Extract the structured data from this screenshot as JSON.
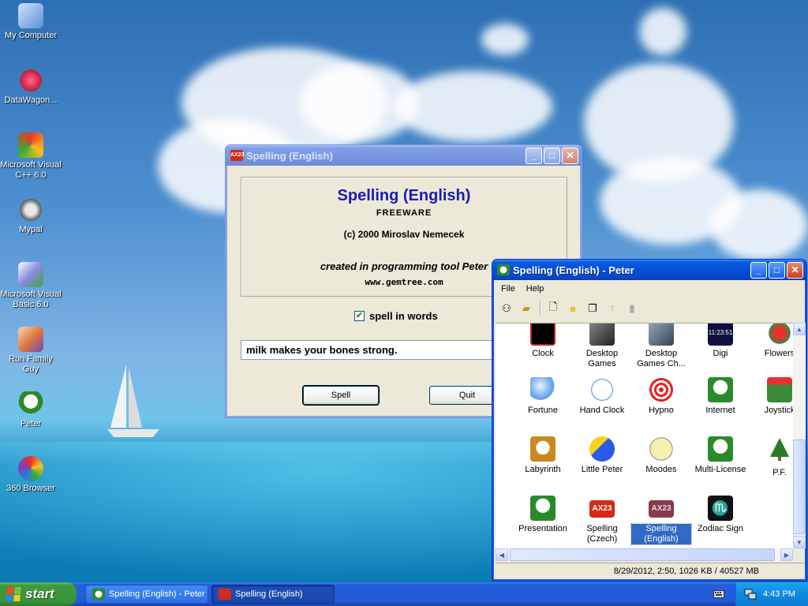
{
  "desktop": {
    "icons": [
      {
        "label": "My Computer"
      },
      {
        "label": "DataWagon..."
      },
      {
        "label": "Microsoft Visual C++ 6.0"
      },
      {
        "label": "Mypal"
      },
      {
        "label": "Microsoft Visual Basic 6.0"
      },
      {
        "label": "Run Family Guy"
      },
      {
        "label": "Peter"
      },
      {
        "label": "360 Browser"
      }
    ]
  },
  "spelling_window": {
    "title": "Spelling (English)",
    "icon_text": "AX23",
    "about": {
      "title": "Spelling (English)",
      "subtitle": "FREEWARE",
      "copyright": "(c) 2000 Miroslav Nemecek",
      "created": "created in programming tool Peter",
      "url": "www.gemtree.com"
    },
    "checkbox_label": "spell in words",
    "checkbox_checked": true,
    "input_value": "milk makes your bones strong.",
    "spell_label": "Spell",
    "quit_label": "Quit"
  },
  "peter_window": {
    "title": "Spelling (English) - Peter",
    "menu": [
      "File",
      "Help"
    ],
    "apps": [
      {
        "label": "Clock"
      },
      {
        "label": "Desktop Games"
      },
      {
        "label": "Desktop Games Ch..."
      },
      {
        "label": "Digi",
        "icon_text": "11:23:51"
      },
      {
        "label": "Flowers"
      },
      {
        "label": "Fortune"
      },
      {
        "label": "Hand Clock"
      },
      {
        "label": "Hypno"
      },
      {
        "label": "Internet"
      },
      {
        "label": "Joystick"
      },
      {
        "label": "Labyrinth"
      },
      {
        "label": "Little Peter"
      },
      {
        "label": "Moodes"
      },
      {
        "label": "Multi-License"
      },
      {
        "label": "P.F."
      },
      {
        "label": "Presentation"
      },
      {
        "label": "Spelling (Czech)",
        "icon_text": "AX23"
      },
      {
        "label": "Spelling (English)",
        "icon_text": "AX23"
      },
      {
        "label": "Zodiac Sign"
      }
    ],
    "status": "8/29/2012, 2:50, 1026 KB / 40527 MB"
  },
  "taskbar": {
    "start_label": "start",
    "tasks": [
      "Spelling (English) - Peter",
      "Spelling (English)"
    ],
    "clock": "4:43 PM"
  }
}
